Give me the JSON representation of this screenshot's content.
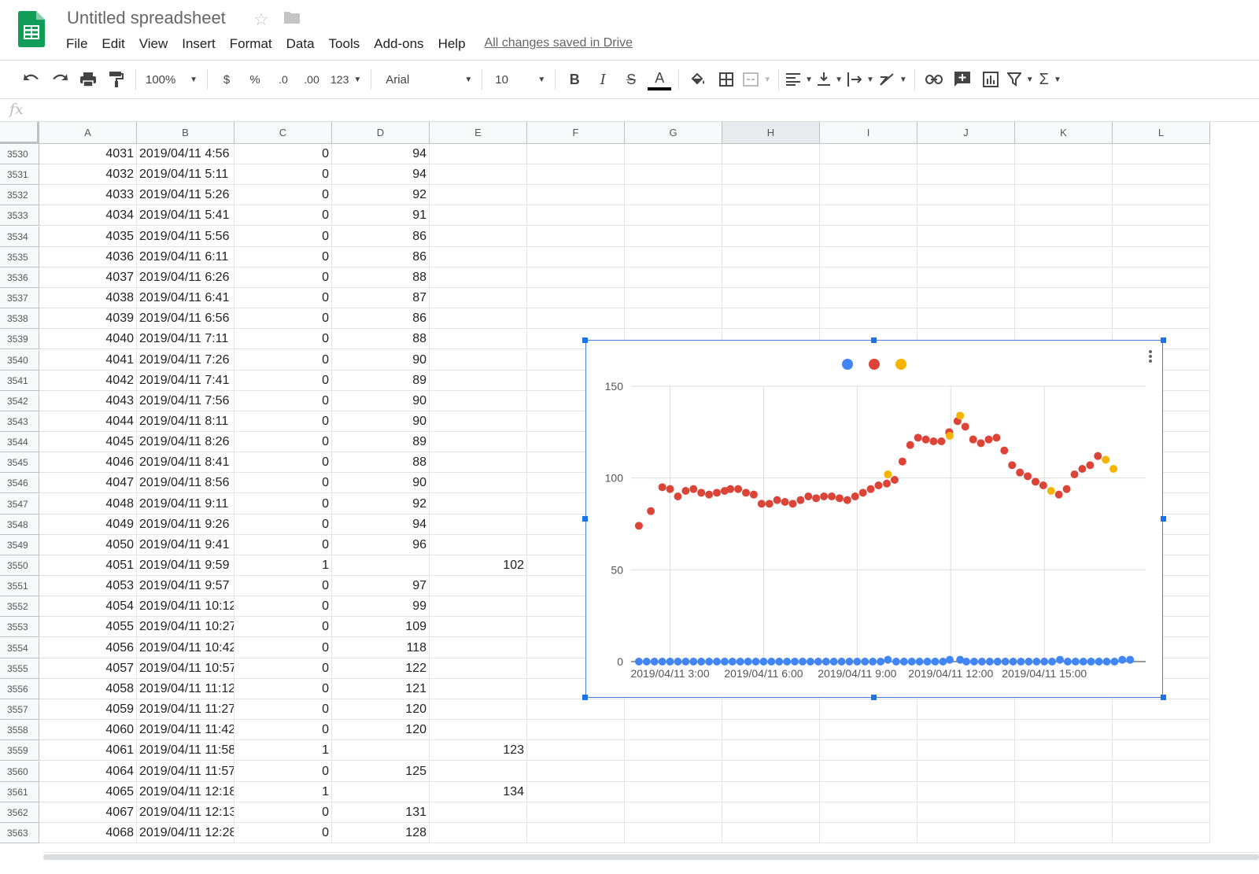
{
  "app": {
    "title": "Untitled spreadsheet",
    "menu": [
      "File",
      "Edit",
      "View",
      "Insert",
      "Format",
      "Data",
      "Tools",
      "Add-ons",
      "Help"
    ],
    "save_status": "All changes saved in Drive"
  },
  "toolbar": {
    "zoom": "100%",
    "currency": "$",
    "percent": "%",
    "decrease_decimal": ".0",
    "increase_decimal": ".00",
    "more_formats": "123",
    "font": "Arial",
    "font_size": "10",
    "bold": "B",
    "italic": "I",
    "strike": "S",
    "text_color": "A",
    "sum": "Σ"
  },
  "formula_bar": {
    "fx": "fx",
    "value": ""
  },
  "columns": [
    "A",
    "B",
    "C",
    "D",
    "E",
    "F",
    "G",
    "H",
    "I",
    "J",
    "K",
    "L"
  ],
  "rows": [
    {
      "n": "3530",
      "a": "4031",
      "b": "2019/04/11 4:56",
      "c": "0",
      "d": "94",
      "e": ""
    },
    {
      "n": "3531",
      "a": "4032",
      "b": "2019/04/11 5:11",
      "c": "0",
      "d": "94",
      "e": ""
    },
    {
      "n": "3532",
      "a": "4033",
      "b": "2019/04/11 5:26",
      "c": "0",
      "d": "92",
      "e": ""
    },
    {
      "n": "3533",
      "a": "4034",
      "b": "2019/04/11 5:41",
      "c": "0",
      "d": "91",
      "e": ""
    },
    {
      "n": "3534",
      "a": "4035",
      "b": "2019/04/11 5:56",
      "c": "0",
      "d": "86",
      "e": ""
    },
    {
      "n": "3535",
      "a": "4036",
      "b": "2019/04/11 6:11",
      "c": "0",
      "d": "86",
      "e": ""
    },
    {
      "n": "3536",
      "a": "4037",
      "b": "2019/04/11 6:26",
      "c": "0",
      "d": "88",
      "e": ""
    },
    {
      "n": "3537",
      "a": "4038",
      "b": "2019/04/11 6:41",
      "c": "0",
      "d": "87",
      "e": ""
    },
    {
      "n": "3538",
      "a": "4039",
      "b": "2019/04/11 6:56",
      "c": "0",
      "d": "86",
      "e": ""
    },
    {
      "n": "3539",
      "a": "4040",
      "b": "2019/04/11 7:11",
      "c": "0",
      "d": "88",
      "e": ""
    },
    {
      "n": "3540",
      "a": "4041",
      "b": "2019/04/11 7:26",
      "c": "0",
      "d": "90",
      "e": ""
    },
    {
      "n": "3541",
      "a": "4042",
      "b": "2019/04/11 7:41",
      "c": "0",
      "d": "89",
      "e": ""
    },
    {
      "n": "3542",
      "a": "4043",
      "b": "2019/04/11 7:56",
      "c": "0",
      "d": "90",
      "e": ""
    },
    {
      "n": "3543",
      "a": "4044",
      "b": "2019/04/11 8:11",
      "c": "0",
      "d": "90",
      "e": ""
    },
    {
      "n": "3544",
      "a": "4045",
      "b": "2019/04/11 8:26",
      "c": "0",
      "d": "89",
      "e": ""
    },
    {
      "n": "3545",
      "a": "4046",
      "b": "2019/04/11 8:41",
      "c": "0",
      "d": "88",
      "e": ""
    },
    {
      "n": "3546",
      "a": "4047",
      "b": "2019/04/11 8:56",
      "c": "0",
      "d": "90",
      "e": ""
    },
    {
      "n": "3547",
      "a": "4048",
      "b": "2019/04/11 9:11",
      "c": "0",
      "d": "92",
      "e": ""
    },
    {
      "n": "3548",
      "a": "4049",
      "b": "2019/04/11 9:26",
      "c": "0",
      "d": "94",
      "e": ""
    },
    {
      "n": "3549",
      "a": "4050",
      "b": "2019/04/11 9:41",
      "c": "0",
      "d": "96",
      "e": ""
    },
    {
      "n": "3550",
      "a": "4051",
      "b": "2019/04/11 9:59",
      "c": "1",
      "d": "",
      "e": "102"
    },
    {
      "n": "3551",
      "a": "4053",
      "b": "2019/04/11 9:57",
      "c": "0",
      "d": "97",
      "e": ""
    },
    {
      "n": "3552",
      "a": "4054",
      "b": "2019/04/11 10:12",
      "c": "0",
      "d": "99",
      "e": ""
    },
    {
      "n": "3553",
      "a": "4055",
      "b": "2019/04/11 10:27",
      "c": "0",
      "d": "109",
      "e": ""
    },
    {
      "n": "3554",
      "a": "4056",
      "b": "2019/04/11 10:42",
      "c": "0",
      "d": "118",
      "e": ""
    },
    {
      "n": "3555",
      "a": "4057",
      "b": "2019/04/11 10:57",
      "c": "0",
      "d": "122",
      "e": ""
    },
    {
      "n": "3556",
      "a": "4058",
      "b": "2019/04/11 11:12",
      "c": "0",
      "d": "121",
      "e": ""
    },
    {
      "n": "3557",
      "a": "4059",
      "b": "2019/04/11 11:27",
      "c": "0",
      "d": "120",
      "e": ""
    },
    {
      "n": "3558",
      "a": "4060",
      "b": "2019/04/11 11:42",
      "c": "0",
      "d": "120",
      "e": ""
    },
    {
      "n": "3559",
      "a": "4061",
      "b": "2019/04/11 11:58",
      "c": "1",
      "d": "",
      "e": "123"
    },
    {
      "n": "3560",
      "a": "4064",
      "b": "2019/04/11 11:57",
      "c": "0",
      "d": "125",
      "e": ""
    },
    {
      "n": "3561",
      "a": "4065",
      "b": "2019/04/11 12:18",
      "c": "1",
      "d": "",
      "e": "134"
    },
    {
      "n": "3562",
      "a": "4067",
      "b": "2019/04/11 12:13",
      "c": "0",
      "d": "131",
      "e": ""
    },
    {
      "n": "3563",
      "a": "4068",
      "b": "2019/04/11 12:28",
      "c": "0",
      "d": "128",
      "e": ""
    }
  ],
  "chart_data": {
    "type": "scatter",
    "title": "",
    "xlabel": "",
    "ylabel": "",
    "legend_position": "top",
    "x_ticks": [
      "2019/04/11 3:00",
      "2019/04/11 6:00",
      "2019/04/11 9:00",
      "2019/04/11 12:00",
      "2019/04/11 15:00"
    ],
    "x_start": "2019/04/11 1:45",
    "x_end": "2019/04/11 18:15",
    "y_ticks": [
      0,
      50,
      100,
      150
    ],
    "ylim": [
      0,
      150
    ],
    "grid": true,
    "series": [
      {
        "color": "#4285f4",
        "points": [
          [
            "2019/04/11 2:00",
            0
          ],
          [
            "2019/04/11 2:15",
            0
          ],
          [
            "2019/04/11 2:30",
            0
          ],
          [
            "2019/04/11 2:45",
            0
          ],
          [
            "2019/04/11 3:00",
            0
          ],
          [
            "2019/04/11 3:15",
            0
          ],
          [
            "2019/04/11 3:30",
            0
          ],
          [
            "2019/04/11 3:45",
            0
          ],
          [
            "2019/04/11 4:00",
            0
          ],
          [
            "2019/04/11 4:15",
            0
          ],
          [
            "2019/04/11 4:30",
            0
          ],
          [
            "2019/04/11 4:45",
            0
          ],
          [
            "2019/04/11 5:00",
            0
          ],
          [
            "2019/04/11 5:15",
            0
          ],
          [
            "2019/04/11 5:30",
            0
          ],
          [
            "2019/04/11 5:45",
            0
          ],
          [
            "2019/04/11 6:00",
            0
          ],
          [
            "2019/04/11 6:15",
            0
          ],
          [
            "2019/04/11 6:30",
            0
          ],
          [
            "2019/04/11 6:45",
            0
          ],
          [
            "2019/04/11 7:00",
            0
          ],
          [
            "2019/04/11 7:15",
            0
          ],
          [
            "2019/04/11 7:30",
            0
          ],
          [
            "2019/04/11 7:45",
            0
          ],
          [
            "2019/04/11 8:00",
            0
          ],
          [
            "2019/04/11 8:15",
            0
          ],
          [
            "2019/04/11 8:30",
            0
          ],
          [
            "2019/04/11 8:45",
            0
          ],
          [
            "2019/04/11 9:00",
            0
          ],
          [
            "2019/04/11 9:15",
            0
          ],
          [
            "2019/04/11 9:30",
            0
          ],
          [
            "2019/04/11 9:45",
            0
          ],
          [
            "2019/04/11 9:59",
            1
          ],
          [
            "2019/04/11 10:15",
            0
          ],
          [
            "2019/04/11 10:30",
            0
          ],
          [
            "2019/04/11 10:45",
            0
          ],
          [
            "2019/04/11 11:00",
            0
          ],
          [
            "2019/04/11 11:15",
            0
          ],
          [
            "2019/04/11 11:30",
            0
          ],
          [
            "2019/04/11 11:45",
            0
          ],
          [
            "2019/04/11 11:58",
            1
          ],
          [
            "2019/04/11 12:18",
            1
          ],
          [
            "2019/04/11 12:30",
            0
          ],
          [
            "2019/04/11 12:45",
            0
          ],
          [
            "2019/04/11 13:00",
            0
          ],
          [
            "2019/04/11 13:15",
            0
          ],
          [
            "2019/04/11 13:30",
            0
          ],
          [
            "2019/04/11 13:45",
            0
          ],
          [
            "2019/04/11 14:00",
            0
          ],
          [
            "2019/04/11 14:15",
            0
          ],
          [
            "2019/04/11 14:30",
            0
          ],
          [
            "2019/04/11 14:45",
            0
          ],
          [
            "2019/04/11 15:00",
            0
          ],
          [
            "2019/04/11 15:15",
            0
          ],
          [
            "2019/04/11 15:30",
            1
          ],
          [
            "2019/04/11 15:45",
            0
          ],
          [
            "2019/04/11 16:00",
            0
          ],
          [
            "2019/04/11 16:15",
            0
          ],
          [
            "2019/04/11 16:30",
            0
          ],
          [
            "2019/04/11 16:45",
            0
          ],
          [
            "2019/04/11 17:00",
            0
          ],
          [
            "2019/04/11 17:15",
            0
          ],
          [
            "2019/04/11 17:30",
            1
          ],
          [
            "2019/04/11 17:45",
            1
          ]
        ]
      },
      {
        "color": "#db4437",
        "points": [
          [
            "2019/04/11 2:00",
            74
          ],
          [
            "2019/04/11 2:23",
            82
          ],
          [
            "2019/04/11 2:45",
            95
          ],
          [
            "2019/04/11 3:00",
            94
          ],
          [
            "2019/04/11 3:15",
            90
          ],
          [
            "2019/04/11 3:30",
            93
          ],
          [
            "2019/04/11 3:45",
            94
          ],
          [
            "2019/04/11 4:00",
            92
          ],
          [
            "2019/04/11 4:15",
            91
          ],
          [
            "2019/04/11 4:30",
            92
          ],
          [
            "2019/04/11 4:45",
            93
          ],
          [
            "2019/04/11 4:56",
            94
          ],
          [
            "2019/04/11 5:11",
            94
          ],
          [
            "2019/04/11 5:26",
            92
          ],
          [
            "2019/04/11 5:41",
            91
          ],
          [
            "2019/04/11 5:56",
            86
          ],
          [
            "2019/04/11 6:11",
            86
          ],
          [
            "2019/04/11 6:26",
            88
          ],
          [
            "2019/04/11 6:41",
            87
          ],
          [
            "2019/04/11 6:56",
            86
          ],
          [
            "2019/04/11 7:11",
            88
          ],
          [
            "2019/04/11 7:26",
            90
          ],
          [
            "2019/04/11 7:41",
            89
          ],
          [
            "2019/04/11 7:56",
            90
          ],
          [
            "2019/04/11 8:11",
            90
          ],
          [
            "2019/04/11 8:26",
            89
          ],
          [
            "2019/04/11 8:41",
            88
          ],
          [
            "2019/04/11 8:56",
            90
          ],
          [
            "2019/04/11 9:11",
            92
          ],
          [
            "2019/04/11 9:26",
            94
          ],
          [
            "2019/04/11 9:41",
            96
          ],
          [
            "2019/04/11 9:57",
            97
          ],
          [
            "2019/04/11 10:12",
            99
          ],
          [
            "2019/04/11 10:27",
            109
          ],
          [
            "2019/04/11 10:42",
            118
          ],
          [
            "2019/04/11 10:57",
            122
          ],
          [
            "2019/04/11 11:12",
            121
          ],
          [
            "2019/04/11 11:27",
            120
          ],
          [
            "2019/04/11 11:42",
            120
          ],
          [
            "2019/04/11 11:57",
            125
          ],
          [
            "2019/04/11 12:13",
            131
          ],
          [
            "2019/04/11 12:28",
            128
          ],
          [
            "2019/04/11 12:43",
            121
          ],
          [
            "2019/04/11 12:58",
            119
          ],
          [
            "2019/04/11 13:13",
            121
          ],
          [
            "2019/04/11 13:28",
            122
          ],
          [
            "2019/04/11 13:43",
            115
          ],
          [
            "2019/04/11 13:58",
            107
          ],
          [
            "2019/04/11 14:13",
            103
          ],
          [
            "2019/04/11 14:28",
            101
          ],
          [
            "2019/04/11 14:43",
            98
          ],
          [
            "2019/04/11 14:58",
            96
          ],
          [
            "2019/04/11 15:28",
            91
          ],
          [
            "2019/04/11 15:43",
            94
          ],
          [
            "2019/04/11 15:58",
            102
          ],
          [
            "2019/04/11 16:13",
            105
          ],
          [
            "2019/04/11 16:28",
            107
          ],
          [
            "2019/04/11 16:43",
            112
          ]
        ]
      },
      {
        "color": "#f4b400",
        "points": [
          [
            "2019/04/11 9:59",
            102
          ],
          [
            "2019/04/11 11:58",
            123
          ],
          [
            "2019/04/11 12:18",
            134
          ],
          [
            "2019/04/11 15:13",
            93
          ],
          [
            "2019/04/11 16:58",
            110
          ],
          [
            "2019/04/11 17:13",
            105
          ]
        ]
      }
    ]
  }
}
